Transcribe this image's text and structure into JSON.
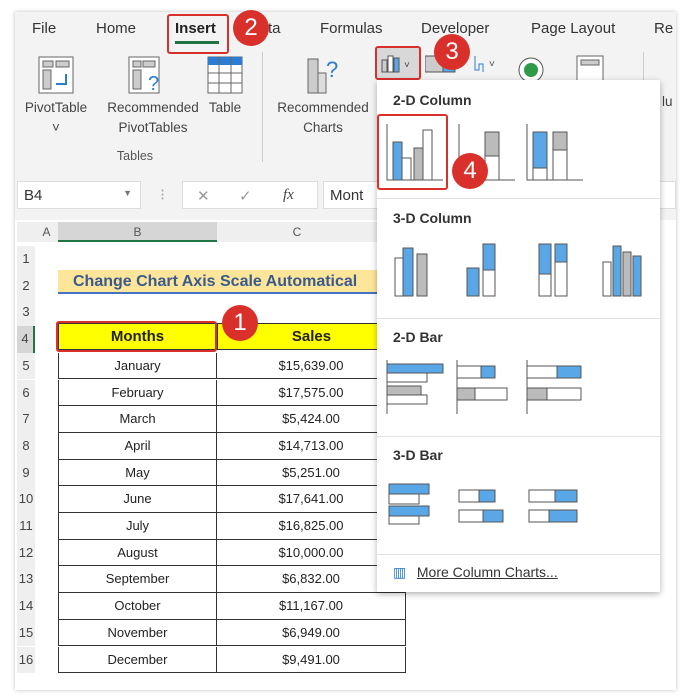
{
  "ribbon": {
    "tabs": [
      "File",
      "Home",
      "Insert",
      "ta",
      "Formulas",
      "Developer",
      "Page Layout",
      "Re"
    ],
    "active_tab": "Insert",
    "buttons": {
      "pivot": "PivotTable",
      "pivot_chev": "˅",
      "recpivot1": "Recommended",
      "recpivot2": "PivotTables",
      "table": "Table",
      "recchart1": "Recommended",
      "recchart2": "Charts",
      "lu": "lu"
    },
    "group": "Tables"
  },
  "formula_bar": {
    "name_box": "B4",
    "content": "Mont",
    "fx": "fx",
    "cancel": "✕",
    "enter": "✓"
  },
  "sheet": {
    "columns": [
      "A",
      "B",
      "C"
    ],
    "rows": [
      "1",
      "2",
      "3",
      "4",
      "5",
      "6",
      "7",
      "8",
      "9",
      "10",
      "11",
      "12",
      "13",
      "14",
      "15",
      "16"
    ],
    "title": "Change Chart Axis Scale Automatical",
    "headers": [
      "Months",
      "Sales"
    ],
    "data": [
      [
        "January",
        "$15,639.00"
      ],
      [
        "February",
        "$17,575.00"
      ],
      [
        "March",
        "$5,424.00"
      ],
      [
        "April",
        "$14,713.00"
      ],
      [
        "May",
        "$5,251.00"
      ],
      [
        "June",
        "$17,641.00"
      ],
      [
        "July",
        "$16,825.00"
      ],
      [
        "August",
        "$10,000.00"
      ],
      [
        "September",
        "$6,832.00"
      ],
      [
        "October",
        "$11,167.00"
      ],
      [
        "November",
        "$6,949.00"
      ],
      [
        "December",
        "$9,491.00"
      ]
    ]
  },
  "dropdown": {
    "sections": [
      "2-D Column",
      "3-D Column",
      "2-D Bar",
      "3-D Bar"
    ],
    "more": "More Column Charts..."
  },
  "badges": [
    "1",
    "2",
    "3",
    "4"
  ],
  "colors": {
    "accent": "#217346",
    "badge": "#d9302c",
    "header_fill": "#ffff00",
    "title_fill": "#fde59a",
    "chart_blue": "#5aa7e8"
  }
}
